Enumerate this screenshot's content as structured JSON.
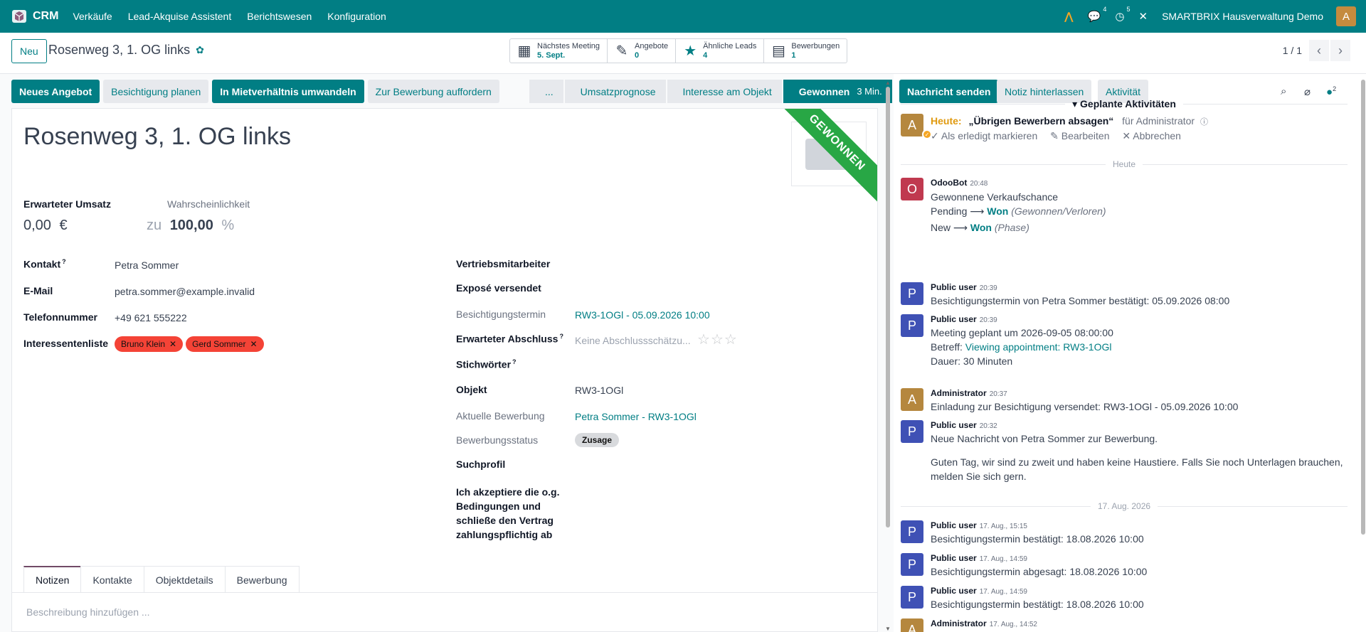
{
  "topnav": {
    "app_name": "CRM",
    "menus": [
      "Verkäufe",
      "Lead-Akquise Assistent",
      "Berichtswesen",
      "Konfiguration"
    ],
    "messages_count": "4",
    "activities_count": "5",
    "company": "SMARTBRIX Hausverwaltung Demo",
    "avatar_letter": "A",
    "accent_color": "#017e84"
  },
  "controlpanel": {
    "new_label": "Neu",
    "breadcrumb": "Rosenweg 3, 1. OG links",
    "smart_buttons": [
      {
        "label": "Nächstes Meeting",
        "value": "5. Sept.",
        "icon": "calendar-icon"
      },
      {
        "label": "Angebote",
        "value": "0",
        "icon": "edit-icon"
      },
      {
        "label": "Ähnliche Leads",
        "value": "4",
        "icon": "star-icon"
      },
      {
        "label": "Bewerbungen",
        "value": "1",
        "icon": "file-icon"
      }
    ],
    "pager": "1 / 1"
  },
  "actions": {
    "buttons": [
      "Neues Angebot",
      "Besichtigung planen",
      "In Mietverhältnis umwandeln",
      "Zur Bewerbung auffordern"
    ],
    "stages": [
      "...",
      "Umsatzprognose",
      "Interesse am Objekt",
      "Gewonnen"
    ],
    "active_stage_duration": "3 Min."
  },
  "form": {
    "title": "Rosenweg 3, 1. OG links",
    "ribbon": "GEWONNEN",
    "expected_revenue_label": "Erwarteter Umsatz",
    "expected_revenue_value": "0,00",
    "currency": "€",
    "probability_label": "Wahrscheinlichkeit",
    "probability_prefix": "zu",
    "probability_value": "100,00",
    "probability_unit": "%",
    "left_fields": [
      {
        "label": "Kontakt",
        "help": "?",
        "value": "Petra Sommer"
      },
      {
        "label": "E-Mail",
        "value": "petra.sommer@example.invalid"
      },
      {
        "label": "Telefonnummer",
        "value": "+49 621 555222"
      },
      {
        "label": "Interessentenliste",
        "value": ""
      }
    ],
    "tags": [
      "Bruno Klein",
      "Gerd Sommer"
    ],
    "tag_color": "#f44336",
    "right_fields": {
      "salesperson": "Vertriebsmitarbeiter",
      "expose": "Exposé versendet",
      "viewing_label": "Besichtigungstermin",
      "viewing_value": "RW3-1OGl - 05.09.2026 10:00",
      "closing_label": "Erwarteter Abschluss",
      "closing_help": "?",
      "closing_placeholder": "Keine Abschlussschätzu...",
      "tags_label": "Stichwörter",
      "tags_help": "?",
      "object_label": "Objekt",
      "object_value": "RW3-1OGl",
      "application_label": "Aktuelle Bewerbung",
      "application_value": "Petra Sommer - RW3-1OGl",
      "app_status_label": "Bewerbungsstatus",
      "app_status_value": "Zusage",
      "search_profile_label": "Suchprofil",
      "accept_label": "Ich akzeptiere die o.g. Bedingungen und schließe den Vertrag zahlungspflichtig ab",
      "accept_lines": [
        "Ich akzeptiere die o.g.",
        "Bedingungen und",
        "schließe den Vertrag",
        "zahlungspflichtig ab"
      ]
    },
    "tabs": [
      "Notizen",
      "Kontakte",
      "Objektdetails",
      "Bewerbung"
    ],
    "description_placeholder": "Beschreibung hinzufügen ..."
  },
  "chatter": {
    "send_message": "Nachricht senden",
    "log_note": "Notiz hinterlassen",
    "activity": "Aktivität",
    "followers_count": "2",
    "planned_title": "Geplante Aktivitäten",
    "planned": {
      "avatar": "A",
      "today": "Heute:",
      "summary": "„Übrigen Bewerbern absagen“",
      "for": "für Administrator",
      "mark_done": "Als erledigt markieren",
      "edit": "Bearbeiten",
      "cancel": "Abbrechen"
    },
    "sep_today": "Heute",
    "sep_date": "17. Aug. 2026",
    "messages": [
      {
        "avatar": "O",
        "color": "#c0394f",
        "author": "OdooBot",
        "time": "20:48",
        "lines": [
          "Gewonnene Verkaufschance"
        ],
        "track1": {
          "from": "Pending",
          "to": "Won",
          "field": "(Gewonnen/Verloren)"
        },
        "track2": {
          "from": "New",
          "to": "Won",
          "field": "(Phase)"
        }
      },
      {
        "avatar": "P",
        "color": "#3f51b5",
        "author": "Public user",
        "time": "20:39",
        "lines": [
          "Besichtigungstermin von Petra Sommer bestätigt: 05.09.2026 08:00"
        ]
      },
      {
        "avatar": "P",
        "color": "#3f51b5",
        "author": "Public user",
        "time": "20:39",
        "lines": [
          "Meeting geplant um 2026-09-05 08:00:00"
        ],
        "subject_label": "Betreff:",
        "subject_link": "Viewing appointment: RW3-1OGl",
        "duration": "Dauer: 30 Minuten"
      },
      {
        "avatar": "A",
        "color": "#b5873e",
        "author": "Administrator",
        "time": "20:37",
        "lines": [
          "Einladung zur Besichtigung versendet: RW3-1OGl - 05.09.2026 10:00"
        ]
      },
      {
        "avatar": "P",
        "color": "#3f51b5",
        "author": "Public user",
        "time": "20:32",
        "lines": [
          "Neue Nachricht von Petra Sommer zur Bewerbung.",
          "Guten Tag, wir sind zu zweit und haben keine Haustiere. Falls Sie noch Unterlagen brauchen,",
          "melden Sie sich gern."
        ]
      },
      {
        "avatar": "P",
        "color": "#3f51b5",
        "author": "Public user",
        "time": "17. Aug., 15:15",
        "lines": [
          "Besichtigungstermin bestätigt: 18.08.2026 10:00"
        ]
      },
      {
        "avatar": "P",
        "color": "#3f51b5",
        "author": "Public user",
        "time": "17. Aug., 14:59",
        "lines": [
          "Besichtigungstermin abgesagt: 18.08.2026 10:00"
        ]
      },
      {
        "avatar": "P",
        "color": "#3f51b5",
        "author": "Public user",
        "time": "17. Aug., 14:59",
        "lines": [
          "Besichtigungstermin bestätigt: 18.08.2026 10:00"
        ]
      },
      {
        "avatar": "A",
        "color": "#b5873e",
        "author": "Administrator",
        "time": "17. Aug., 14:52",
        "lines": []
      }
    ]
  }
}
